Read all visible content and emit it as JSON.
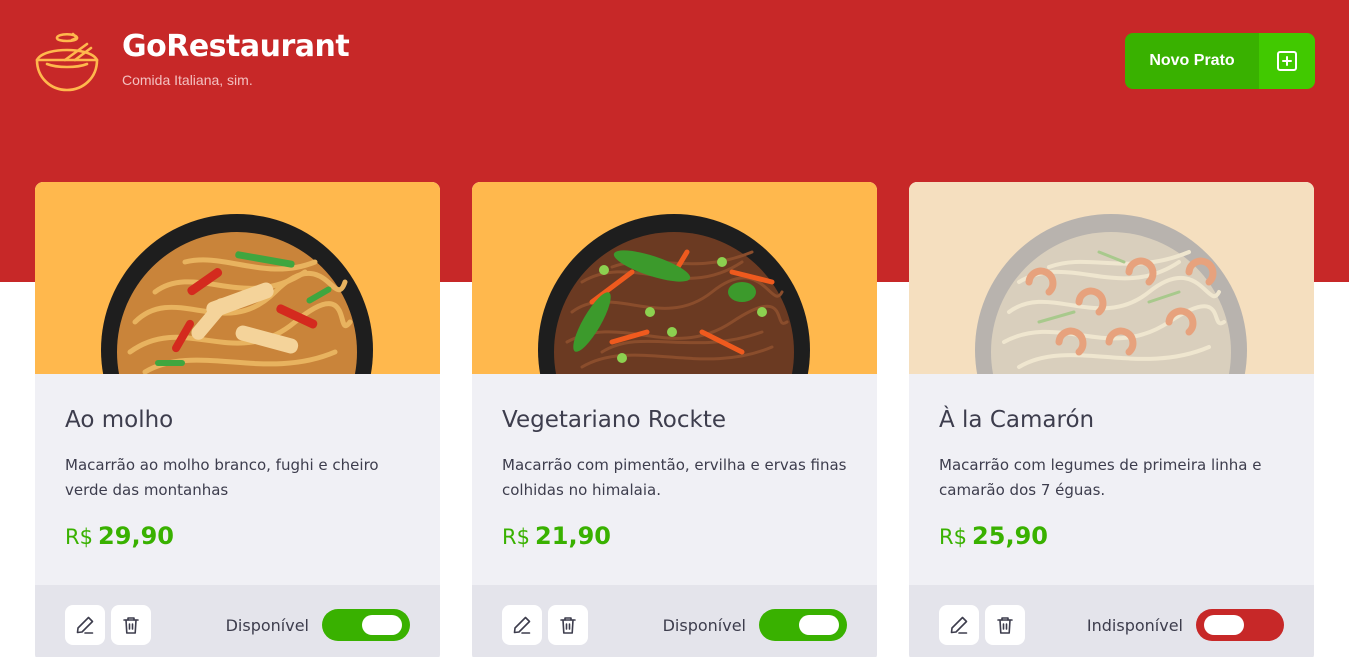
{
  "header": {
    "title": "GoRestaurant",
    "subtitle": "Comida Italiana, sim.",
    "new_button_label": "Novo Prato"
  },
  "colors": {
    "header_red": "#c72828",
    "green": "#39b100",
    "green_light": "#41c900",
    "card_bg": "#f0f0f5",
    "card_image_bg": "#ffb84d"
  },
  "foods": [
    {
      "name": "Ao molho",
      "description": "Macarrão ao molho branco, fughi e cheiro verde das montanhas",
      "currency": "R$",
      "price": "29,90",
      "availability_label": "Disponível",
      "available": true
    },
    {
      "name": "Vegetariano Rockte",
      "description": "Macarrão com pimentão, ervilha e ervas finas colhidas no himalaia.",
      "currency": "R$",
      "price": "21,90",
      "availability_label": "Disponível",
      "available": true
    },
    {
      "name": "À la Camarón",
      "description": "Macarrão com legumes de primeira linha e camarão dos 7 éguas.",
      "currency": "R$",
      "price": "25,90",
      "availability_label": "Indisponível",
      "available": false
    }
  ]
}
